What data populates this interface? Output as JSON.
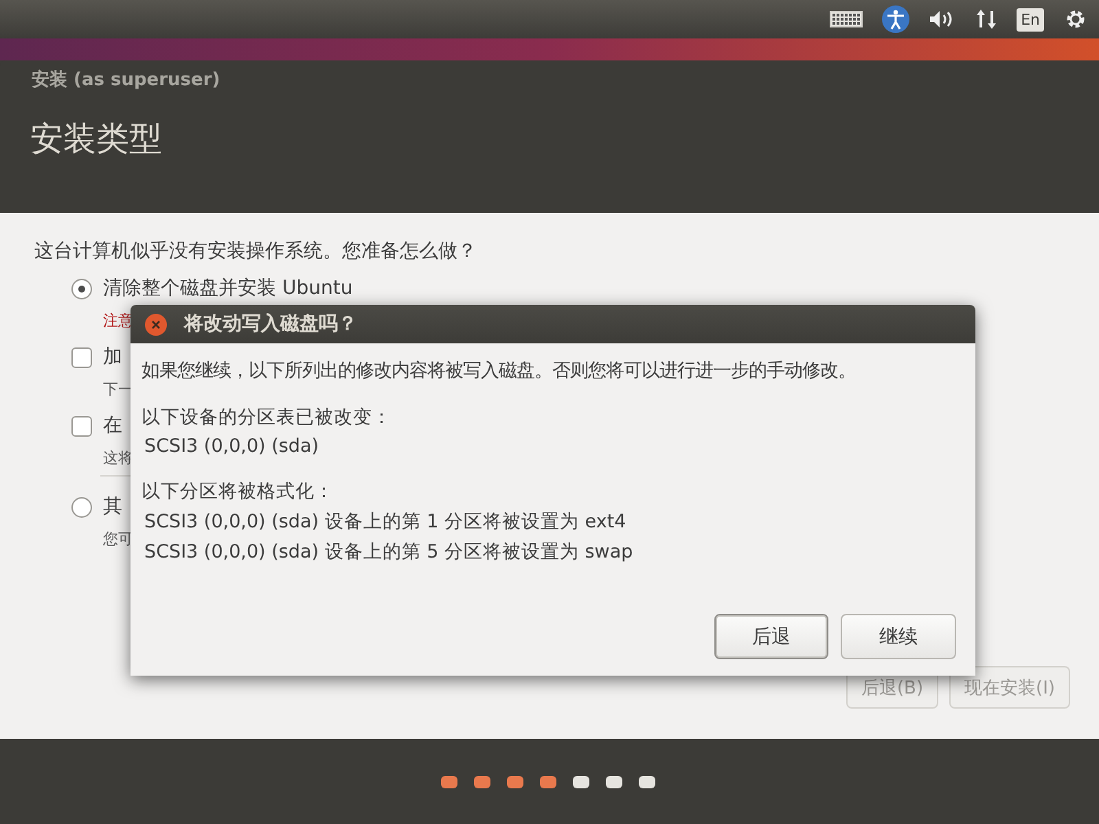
{
  "top_panel": {
    "language": "En"
  },
  "window": {
    "title": "安装 (as superuser)",
    "heading": "安装类型"
  },
  "question": "这台计算机似乎没有安装操作系统。您准备怎么做？",
  "options": [
    {
      "kind": "radio",
      "selected": true,
      "label": "清除整个磁盘并安装 Ubuntu",
      "note": "注意",
      "warning": true
    },
    {
      "kind": "checkbox",
      "checked": false,
      "label": "加",
      "note": "下一"
    },
    {
      "kind": "checkbox",
      "checked": false,
      "label": "在",
      "note": "这将"
    },
    {
      "kind": "radio",
      "selected": false,
      "label": "其",
      "note": "您可"
    }
  ],
  "buttons": [
    {
      "label": "后退(B)"
    },
    {
      "label": "现在安装(I)"
    }
  ],
  "progress_dots": [
    {
      "done": true
    },
    {
      "done": true
    },
    {
      "done": true
    },
    {
      "done": true
    },
    {
      "done": false
    },
    {
      "done": false
    },
    {
      "done": false
    }
  ],
  "dialog": {
    "title": "将改动写入磁盘吗？",
    "message": "如果您继续，以下所列出的修改内容将被写入磁盘。否则您将可以进行进一步的手动修改。",
    "sections": [
      {
        "heading": "以下设备的分区表已被改变：",
        "lines": [
          "SCSI3 (0,0,0) (sda)"
        ]
      },
      {
        "heading": "以下分区将被格式化：",
        "lines": [
          "SCSI3 (0,0,0) (sda) 设备上的第 1 分区将被设置为 ext4",
          "SCSI3 (0,0,0) (sda) 设备上的第 5 分区将被设置为 swap"
        ]
      }
    ],
    "buttons": [
      {
        "label": "后退",
        "default": true
      },
      {
        "label": "继续",
        "default": false
      }
    ]
  }
}
